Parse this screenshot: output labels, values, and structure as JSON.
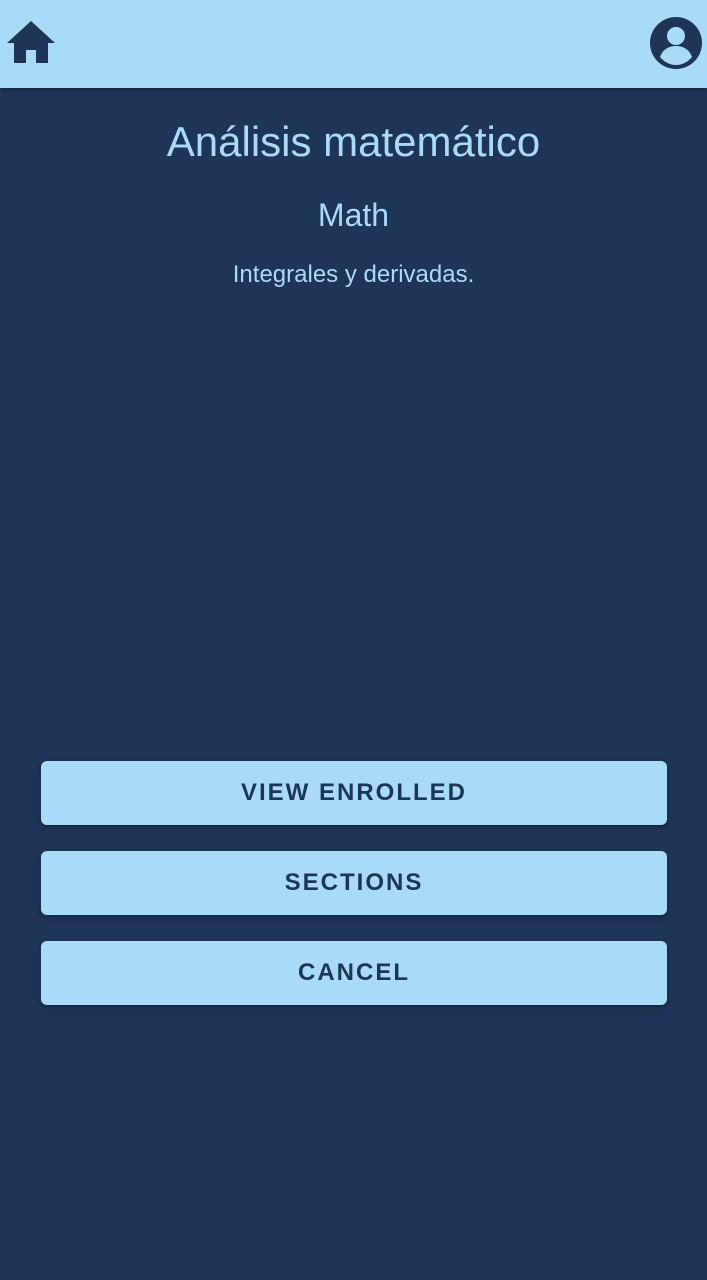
{
  "colors": {
    "background": "#1e3557",
    "accent": "#a7dbf8"
  },
  "header": {
    "home_icon": "home-icon",
    "profile_icon": "account-circle-icon"
  },
  "course": {
    "title": "Análisis matemático",
    "subject": "Math",
    "description": "Integrales y derivadas."
  },
  "actions": {
    "view_enrolled_label": "VIEW ENROLLED",
    "sections_label": "SECTIONS",
    "cancel_label": "CANCEL"
  }
}
